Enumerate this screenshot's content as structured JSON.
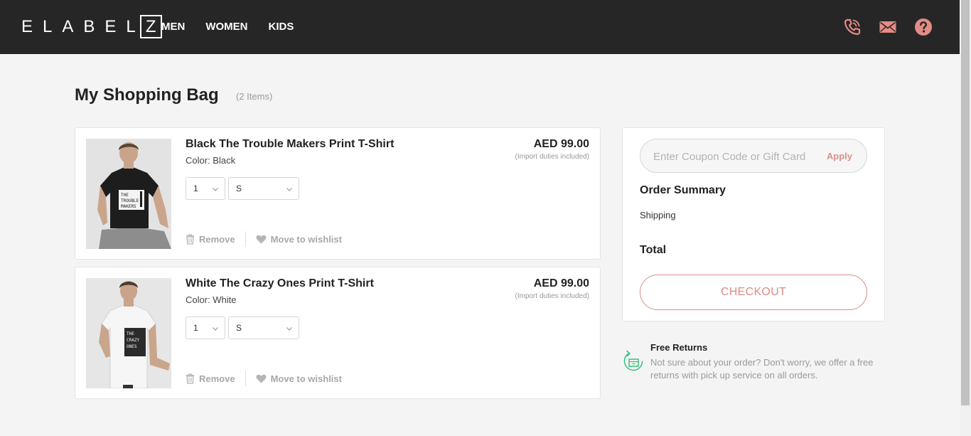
{
  "header": {
    "logo": {
      "letters": "ELABEL",
      "boxed": "Z"
    },
    "nav": [
      "MEN",
      "WOMEN",
      "KIDS"
    ],
    "icons": [
      "phone-icon",
      "mail-icon",
      "help-icon"
    ],
    "icon_color": "#e38c85"
  },
  "page": {
    "title": "My Shopping Bag",
    "item_count": "(2 Items)"
  },
  "cart": {
    "items": [
      {
        "name": "Black The Trouble Makers Print T-Shirt",
        "color": "Color: Black",
        "price": "AED 99.00",
        "duty_note": "(Import duties included)",
        "qty": "1",
        "size": "S",
        "remove_label": "Remove",
        "wishlist_label": "Move to wishlist",
        "shirt_color": "#1d1d1d",
        "shirt_print": [
          "THE",
          "TROUBLE",
          "MAKERS"
        ]
      },
      {
        "name": "White The Crazy Ones Print T-Shirt",
        "color": "Color: White",
        "price": "AED 99.00",
        "duty_note": "(Import duties included)",
        "qty": "1",
        "size": "S",
        "remove_label": "Remove",
        "wishlist_label": "Move to wishlist",
        "shirt_color": "#f2f2f2",
        "shirt_print": [
          "THE",
          "CRAZY",
          "ONES"
        ]
      }
    ]
  },
  "summary": {
    "coupon_placeholder": "Enter Coupon Code or Gift Card",
    "apply_label": "Apply",
    "title": "Order Summary",
    "shipping_label": "Shipping",
    "total_label": "Total",
    "checkout_label": "CHECKOUT"
  },
  "returns": {
    "title": "Free Returns",
    "text": "Not sure about your order? Don't worry, we offer a free returns with pick up service on all orders."
  }
}
